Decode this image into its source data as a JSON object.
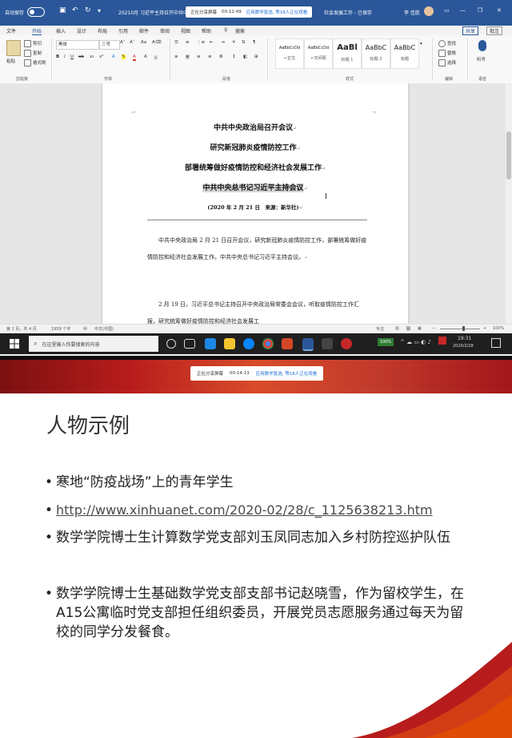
{
  "word": {
    "titlebar": {
      "autosave": "自动保存",
      "autosave_state": "关",
      "doc_title": "20210月 习近平主持召开中共中央",
      "share_status": "正在分享屏幕",
      "share_time": "00:12:49",
      "meeting_info": "应用数学复选, 等18人正在观看",
      "doc_title_tail": "社会发展工作 - 已保存",
      "user": "李 佳航",
      "window_buttons": [
        "—",
        "❐",
        "✕"
      ]
    },
    "tabs": [
      "文件",
      "开始",
      "插入",
      "设计",
      "布局",
      "引用",
      "邮件",
      "审阅",
      "视图",
      "帮助",
      "♀",
      "搜索"
    ],
    "active_tab": "开始",
    "share_button": "共享",
    "comment_button": "批注",
    "ribbon": {
      "clipboard": {
        "paste": "粘贴",
        "cut": "剪切",
        "copy": "复制",
        "format_painter": "格式刷",
        "label": "剪贴板"
      },
      "font": {
        "font_name": "黑体",
        "font_size": "三号",
        "label": "字体"
      },
      "paragraph": {
        "label": "段落"
      },
      "styles": {
        "label": "样式",
        "items": [
          {
            "preview": "AaBbCcDd",
            "name": "↵正文"
          },
          {
            "preview": "AaBbCcDd",
            "name": "↵无间隔"
          },
          {
            "preview": "AaBl",
            "name": "标题 1"
          },
          {
            "preview": "AaBbC",
            "name": "标题 2"
          },
          {
            "preview": "AaBbC",
            "name": "标题"
          }
        ]
      },
      "editing": {
        "find": "查找",
        "replace": "替换",
        "select": "选择",
        "label": "编辑"
      },
      "voice": {
        "dictate": "听写",
        "label": "语音"
      }
    },
    "document": {
      "headings": [
        "中共中央政治局召开会议",
        "研究新冠肺炎疫情防控工作",
        "部署统筹做好疫情防控和经济社会发展工作",
        "中共中央总书记习近平主持会议"
      ],
      "source_line": "(2020 年 2 月 21 日　来源：新华社)",
      "paragraph1": "中共中央政治局 2 月 21 日召开会议，研究新冠肺炎疫情防控工作，部署统筹做好疫情防控和经济社会发展工作。中共中央总书记习近平主持会议。",
      "paragraph2": "2 月 19 日，习近平总书记主持召开中央政治局常委会会议，听取疫情防控工作汇报，研究统筹做好疫情防控和经济社会发展工"
    },
    "statusbar": {
      "page": "第 1 页，共 4 页",
      "words": "1959 个字",
      "language": "中文(中国)",
      "focus": "专注",
      "zoom": "100%"
    },
    "taskbar": {
      "search_placeholder": "在这里输入你要搜索的内容",
      "battery": "100%",
      "time": "19:31",
      "date": "2020/2/28"
    }
  },
  "slide": {
    "share_status": "正在分享屏幕",
    "share_time": "00:14:13",
    "meeting_info": "应用数学复选, 等18人正在观看",
    "title": "人物示例",
    "bullets": [
      "寒地“防疫战场”上的青年学生",
      "http://www.xinhuanet.com/2020-02/28/c_1125638213.htm",
      "数学学院博士生计算数学党支部刘玉凤同志加入乡村防控巡护队伍",
      "数学学院博士生基础数学党支部支部书记赵晓雪，作为留校学生，在A15公寓临时党支部担任组织委员，开展党员志愿服务通过每天为留校的同学分发餐食。"
    ],
    "colors": {
      "banner": "#b71c1c",
      "accent": "#c62828"
    }
  }
}
